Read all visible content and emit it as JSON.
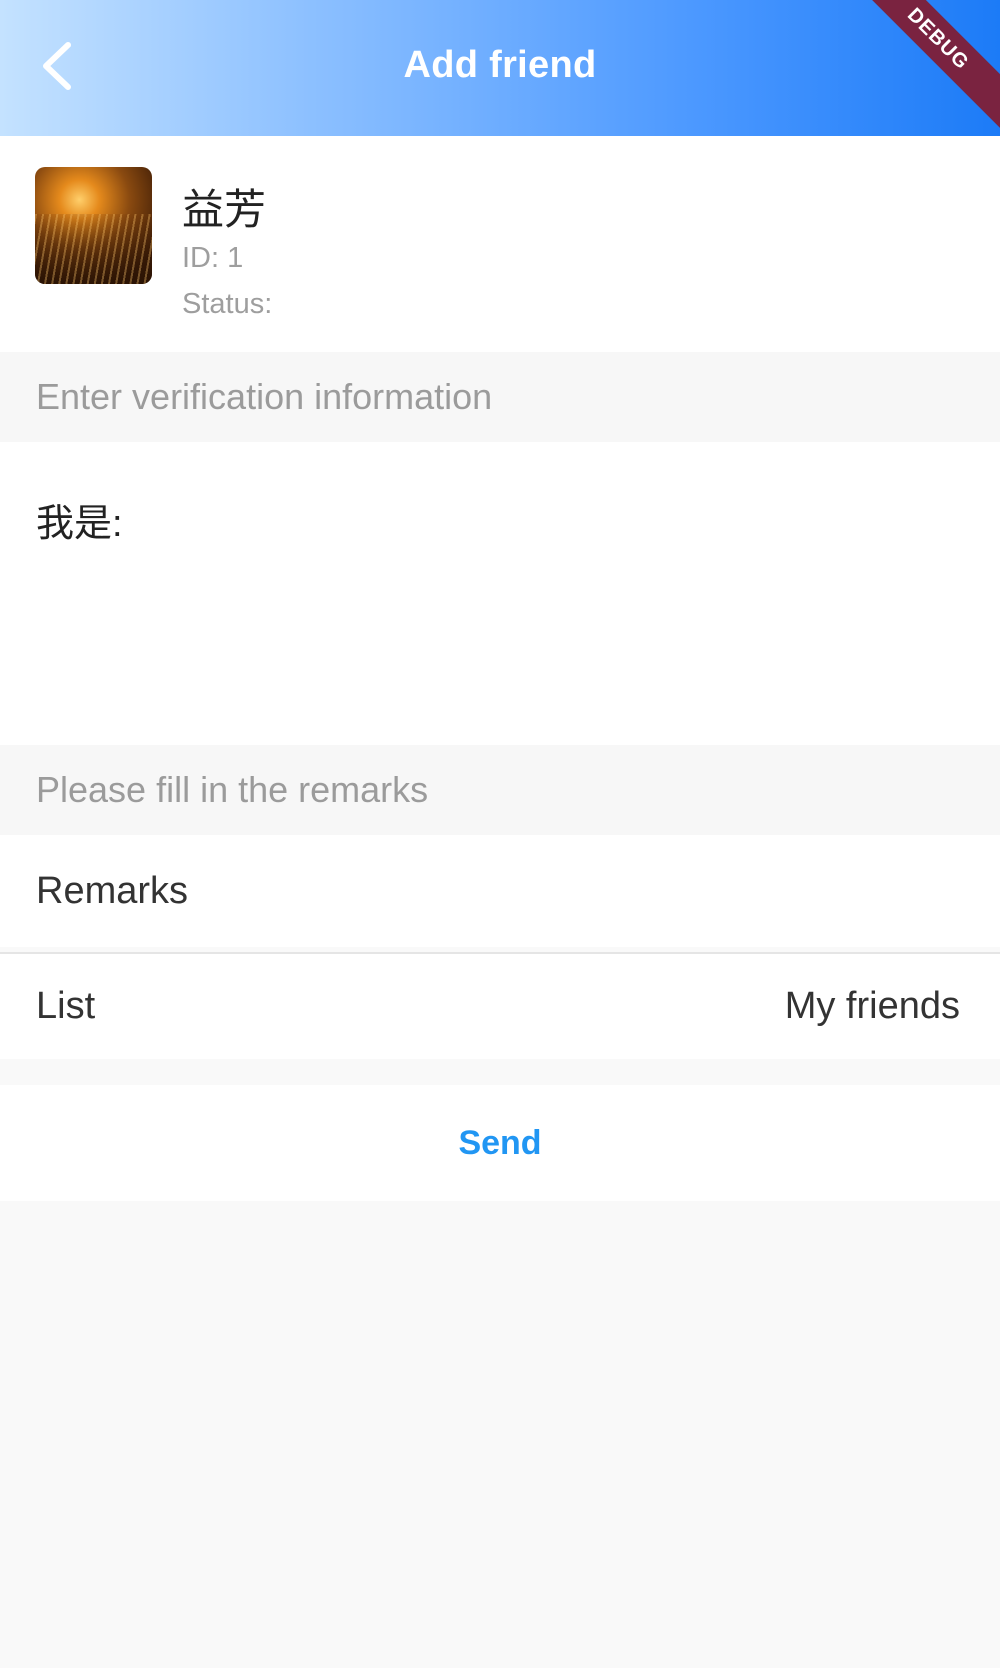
{
  "appbar": {
    "title": "Add friend",
    "back_icon": "chevron-left-icon",
    "debug_banner": "DEBUG",
    "gradient": [
      "#c4e2ff",
      "#1c7bf7"
    ]
  },
  "profile": {
    "name": "益芳",
    "id_text": "ID: 1",
    "status_text": "Status:"
  },
  "verification": {
    "section_label": "Enter verification information",
    "value": "我是:"
  },
  "remarks": {
    "section_label": "Please fill in the remarks",
    "remarks_label": "Remarks",
    "list_label": "List",
    "list_value": "My friends"
  },
  "actions": {
    "send_label": "Send",
    "send_color": "#2196f3"
  }
}
